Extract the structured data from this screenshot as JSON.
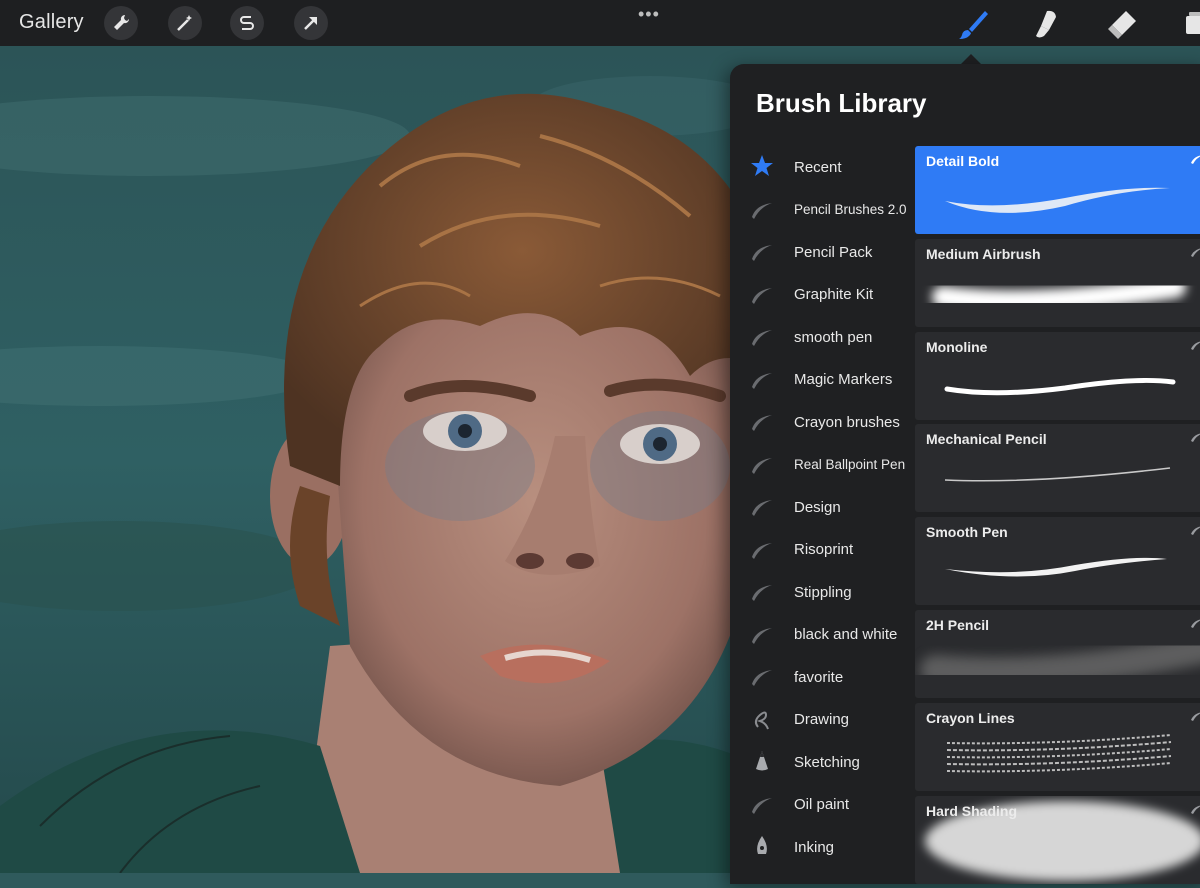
{
  "toolbar": {
    "gallery_label": "Gallery",
    "left_tools": [
      "wrench-icon",
      "magic-wand-icon",
      "selection-s-icon",
      "transform-arrow-icon"
    ],
    "more_label": "•••",
    "right_tools": [
      "brush-icon",
      "smudge-icon",
      "eraser-icon",
      "layers-icon"
    ],
    "active_tool_color": "#2f7bf5"
  },
  "library": {
    "title": "Brush Library",
    "sets": [
      {
        "label": "Recent",
        "icon": "star-icon"
      },
      {
        "label": "Pencil Brushes 2.0",
        "icon": "brush-stroke-icon"
      },
      {
        "label": "Pencil Pack",
        "icon": "brush-stroke-icon"
      },
      {
        "label": "Graphite Kit",
        "icon": "brush-stroke-icon"
      },
      {
        "label": "smooth pen",
        "icon": "brush-stroke-icon"
      },
      {
        "label": "Magic Markers",
        "icon": "brush-stroke-icon"
      },
      {
        "label": "Crayon brushes",
        "icon": "brush-stroke-icon"
      },
      {
        "label": "Real Ballpoint Pen",
        "icon": "brush-stroke-icon"
      },
      {
        "label": "Design",
        "icon": "brush-stroke-icon"
      },
      {
        "label": "Risoprint",
        "icon": "brush-stroke-icon"
      },
      {
        "label": "Stippling",
        "icon": "brush-stroke-icon"
      },
      {
        "label": "black and white",
        "icon": "brush-stroke-icon"
      },
      {
        "label": "favorite",
        "icon": "brush-stroke-icon"
      },
      {
        "label": "Drawing",
        "icon": "squiggle-icon"
      },
      {
        "label": "Sketching",
        "icon": "pencil-tip-icon"
      },
      {
        "label": "Oil paint",
        "icon": "brush-stroke-icon"
      },
      {
        "label": "Inking",
        "icon": "pen-nib-icon"
      }
    ],
    "brushes": [
      {
        "name": "Detail Bold",
        "selected": true
      },
      {
        "name": "Medium Airbrush",
        "selected": false
      },
      {
        "name": "Monoline",
        "selected": false
      },
      {
        "name": "Mechanical Pencil",
        "selected": false
      },
      {
        "name": "Smooth Pen",
        "selected": false
      },
      {
        "name": "2H Pencil",
        "selected": false
      },
      {
        "name": "Crayon Lines",
        "selected": false
      },
      {
        "name": "Hard Shading",
        "selected": false
      }
    ]
  }
}
